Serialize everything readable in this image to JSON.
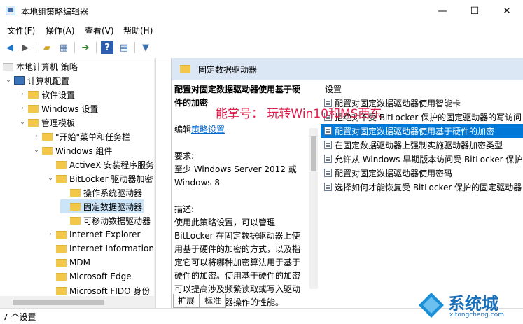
{
  "window": {
    "title": "本地组策略编辑器",
    "minimize": "—",
    "maximize": "☐",
    "close": "✕"
  },
  "menu": [
    "文件(F)",
    "操作(A)",
    "查看(V)",
    "帮助(H)"
  ],
  "toolbar": {
    "icons": [
      "back-icon",
      "forward-icon",
      "up-folder-icon",
      "show-hide-tree-icon",
      "export-icon",
      "help-icon",
      "properties-icon",
      "filter-icon"
    ]
  },
  "tree": {
    "root": "本地计算机 策略",
    "computer_config": "计算机配置",
    "software_settings": "软件设置",
    "windows_settings": "Windows 设置",
    "admin_templates": "管理模板",
    "start_menu": "\"开始\"菜单和任务栏",
    "windows_components": "Windows 组件",
    "activex": "ActiveX 安装程序服务",
    "bitlocker": "BitLocker 驱动器加密",
    "os_drives": "操作系统驱动器",
    "fixed_drives": "固定数据驱动器",
    "removable_drives": "可移动数据驱动器",
    "ie": "Internet Explorer",
    "iis": "Internet Information",
    "mdm": "MDM",
    "edge": "Microsoft Edge",
    "fido": "Microsoft FIDO 身份"
  },
  "right": {
    "header": "固定数据驱动器",
    "desc_title": "配置对固定数据驱动器使用基于硬件的加密",
    "edit_prefix": "编辑",
    "edit_link": "策略设置",
    "req_label": "要求:",
    "req_text": "至少 Windows Server 2012 或 Windows 8",
    "desc_label": "描述:",
    "desc_text": "使用此策略设置，可以管理 BitLocker 在固定数据驱动器上使用基于硬件的加密的方式，以及指定它可以将哪种加密算法用于基于硬件的加密。使用基于硬件的加密可以提高涉及频繁读取或写入驱动器数据的驱动器操作的性能。",
    "list_header": "设置",
    "items": [
      "配置对固定数据驱动器使用智能卡",
      "拒绝对不受 BitLocker 保护的固定驱动器的写访问",
      "配置对固定数据驱动器使用基于硬件的加密",
      "在固定数据驱动器上强制实施驱动器加密类型",
      "允许从 Windows 早期版本访问受 BitLocker 保护",
      "配置对固定数据驱动器使用密码",
      "选择如何才能恢复受 BitLocker 保护的固定驱动器"
    ],
    "tabs": [
      "扩展",
      "标准"
    ]
  },
  "status": "7 个设置",
  "watermark": "能掌号： 玩转Win10和MS西东",
  "logo": {
    "name": "系统城",
    "url": "xitongcheng.com"
  }
}
